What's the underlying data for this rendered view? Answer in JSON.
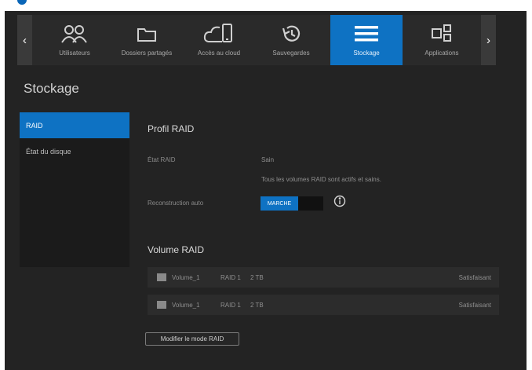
{
  "colors": {
    "accent": "#0e72c3",
    "background": "#232323",
    "sidebar": "#1b1b1b"
  },
  "nav": {
    "items": [
      {
        "label": "Utilisateurs",
        "icon": "users-icon",
        "active": false
      },
      {
        "label": "Dossiers partagés",
        "icon": "folder-icon",
        "active": false
      },
      {
        "label": "Accès au cloud",
        "icon": "cloud-device-icon",
        "active": false
      },
      {
        "label": "Sauvegardes",
        "icon": "history-icon",
        "active": false
      },
      {
        "label": "Stockage",
        "icon": "storage-icon",
        "active": true
      },
      {
        "label": "Applications",
        "icon": "apps-icon",
        "active": false
      }
    ],
    "prev_arrow": "‹",
    "next_arrow": "›"
  },
  "page_title": "Stockage",
  "sidebar": {
    "items": [
      {
        "label": "RAID",
        "active": true
      },
      {
        "label": "État du disque",
        "active": false
      }
    ]
  },
  "raid_profile": {
    "title": "Profil RAID",
    "state_label": "État RAID",
    "state_value": "Sain",
    "state_note": "Tous les volumes RAID sont actifs et sains.",
    "auto_rebuild_label": "Reconstruction auto",
    "toggle_on_label": "MARCHE",
    "toggle_on": true
  },
  "raid_volume": {
    "title": "Volume RAID",
    "rows": [
      {
        "name": "Volume_1",
        "raid": "RAID 1",
        "size": "2 TB",
        "status": "Satisfaisant"
      },
      {
        "name": "Volume_1",
        "raid": "RAID 1",
        "size": "2 TB",
        "status": "Satisfaisant"
      }
    ]
  },
  "modify_button": "Modifier le mode RAID"
}
